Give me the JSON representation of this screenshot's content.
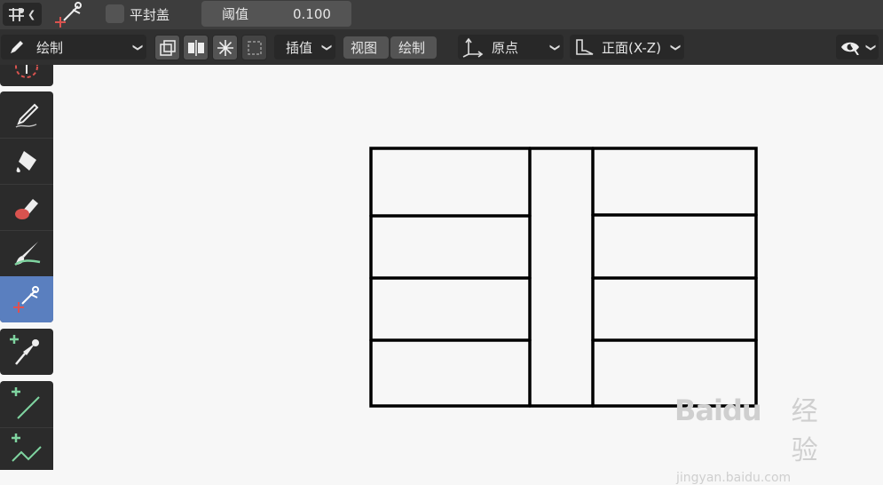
{
  "topbar": {
    "icons": [
      "annotation-tool-icon",
      "cutter-tool-icon"
    ],
    "flat_caps_label": "平封盖",
    "flat_caps_checked": false,
    "threshold_label": "阈值",
    "threshold_value": "0.100"
  },
  "toolbar": {
    "mode_label": "绘制",
    "interpolate_label": "插值",
    "view_label": "视图",
    "draw_label": "绘制",
    "origin_label": "原点",
    "plane_label": "正面(X-Z)"
  },
  "sidebar": {
    "tools": [
      {
        "name": "cursor-tool",
        "icon": "cursor-icon"
      },
      {
        "name": "draw-tool",
        "icon": "pencil-icon"
      },
      {
        "name": "fill-tool",
        "icon": "bucket-icon"
      },
      {
        "name": "erase-tool",
        "icon": "eraser-icon"
      },
      {
        "name": "tint-tool",
        "icon": "brush-icon"
      },
      {
        "name": "cutter-tool",
        "icon": "scissors-icon",
        "active": true
      },
      {
        "name": "eyedropper-tool",
        "icon": "eyedropper-icon"
      },
      {
        "name": "line-tool",
        "icon": "line-icon"
      },
      {
        "name": "polyline-tool",
        "icon": "polyline-icon"
      }
    ]
  },
  "watermark": {
    "brand": "Baidu",
    "chinese": "经验",
    "url": "jingyan.baidu.com"
  },
  "colors": {
    "topbar_bg": "#3d3d3d",
    "toolbar_bg": "#303030",
    "active_tool": "#5a7fbf",
    "canvas_bg": "#f7f7f7",
    "stroke": "#000000"
  }
}
